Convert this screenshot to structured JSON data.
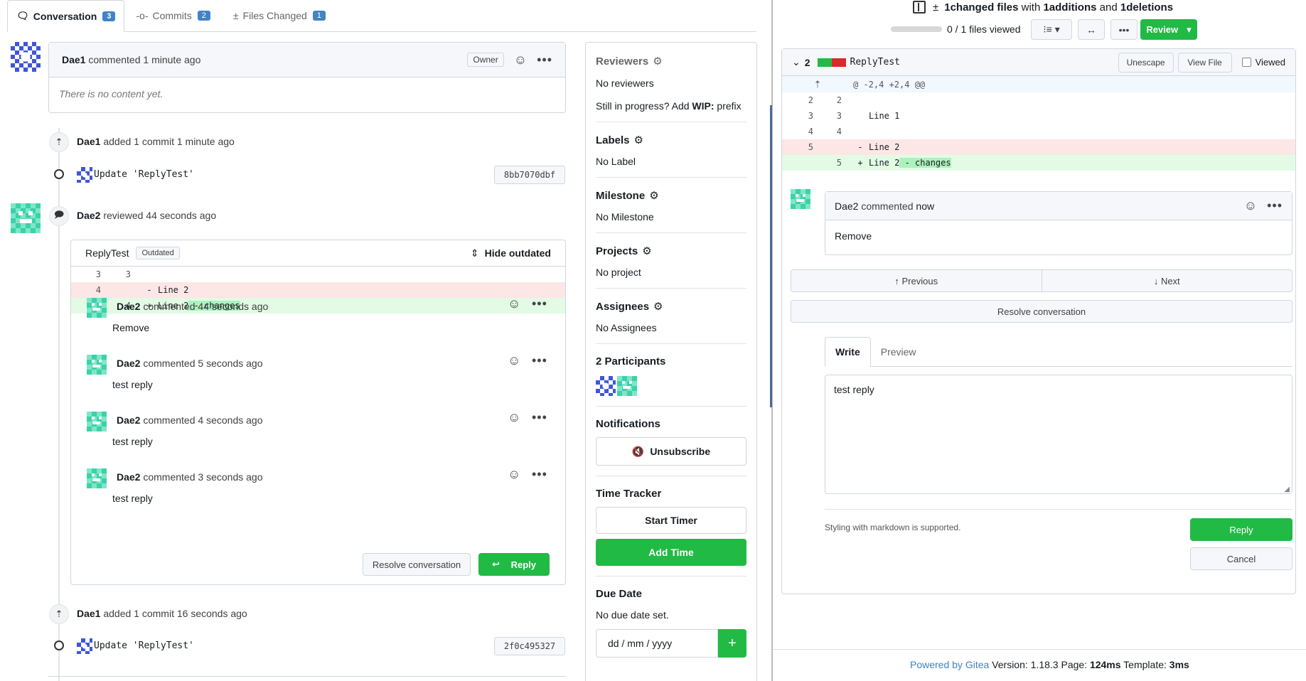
{
  "tabs": [
    {
      "label": "Conversation",
      "count": "3"
    },
    {
      "label": "Commits",
      "count": "2"
    },
    {
      "label": "Files Changed",
      "count": "1"
    }
  ],
  "first_comment": {
    "author": "Dae1",
    "action": "commented",
    "time": "1 minute ago",
    "role": "Owner",
    "body": "There is no content yet."
  },
  "event1": {
    "author": "Dae1",
    "text": "added 1 commit 1 minute ago",
    "commit_msg": "Update 'ReplyTest'",
    "sha": "8bb7070dbf"
  },
  "review": {
    "author": "Dae2",
    "text": "reviewed 44 seconds ago",
    "file": "ReplyTest",
    "outdated": "Outdated",
    "hide_outdated": "Hide outdated",
    "diff": [
      {
        "old": "3",
        "new": "3",
        "sign": "",
        "code": ""
      },
      {
        "old": "4",
        "new": "",
        "sign": "-",
        "code": "Line 2"
      },
      {
        "old": "",
        "new": "4",
        "sign": "+",
        "code": "Line 2",
        "hl": " - changes"
      }
    ],
    "comments": [
      {
        "author": "Dae2",
        "action": "commented",
        "time": "44 seconds ago",
        "body": "Remove"
      },
      {
        "author": "Dae2",
        "action": "commented",
        "time": "5 seconds ago",
        "body": "test reply"
      },
      {
        "author": "Dae2",
        "action": "commented",
        "time": "4 seconds ago",
        "body": "test reply"
      },
      {
        "author": "Dae2",
        "action": "commented",
        "time": "3 seconds ago",
        "body": "test reply"
      }
    ],
    "resolve_label": "Resolve conversation",
    "reply_label": "Reply"
  },
  "event2": {
    "author": "Dae1",
    "text": "added 1 commit 16 seconds ago",
    "commit_msg": "Update 'ReplyTest'",
    "sha": "2f0c495327"
  },
  "sidebar": {
    "reviewers_h": "Reviewers",
    "reviewers_v": "No reviewers",
    "wip_pre": "Still in progress? Add ",
    "wip_b": "WIP:",
    "wip_post": " prefix",
    "labels_h": "Labels",
    "labels_v": "No Label",
    "milestone_h": "Milestone",
    "milestone_v": "No Milestone",
    "projects_h": "Projects",
    "projects_v": "No project",
    "assignees_h": "Assignees",
    "assignees_v": "No Assignees",
    "participants_h": "2 Participants",
    "notifications_h": "Notifications",
    "unsubscribe": "Unsubscribe",
    "time_h": "Time Tracker",
    "start_timer": "Start Timer",
    "add_time": "Add Time",
    "due_h": "Due Date",
    "due_v": "No due date set.",
    "date_placeholder": "dd / mm / yyyy",
    "plus": "+"
  },
  "right": {
    "summary": {
      "count": "1",
      "a": " changed files",
      "with": " with ",
      "adds": "1",
      "a2": " additions",
      "and": " and ",
      "dels": "1",
      "a3": " deletions"
    },
    "progress": "0 / 1 files viewed",
    "review_btn": "Review",
    "file": {
      "count": "2",
      "name": "ReplyTest",
      "unescape": "Unescape",
      "view_file": "View File",
      "viewed": "Viewed"
    },
    "hunk": "@ -2,4 +2,4 @@",
    "diff": [
      {
        "old": "2",
        "new": "2",
        "sign": "",
        "code": ""
      },
      {
        "old": "3",
        "new": "3",
        "sign": "",
        "code": "Line 1"
      },
      {
        "old": "4",
        "new": "4",
        "sign": "",
        "code": ""
      },
      {
        "old": "5",
        "new": "",
        "sign": "-",
        "code": "Line 2"
      },
      {
        "old": "",
        "new": "5",
        "sign": "+",
        "code": "Line 2",
        "hl": " - changes"
      }
    ],
    "comment": {
      "author": "Dae2",
      "action": "commented",
      "time": "now",
      "body": "Remove"
    },
    "previous": "↑ Previous",
    "next": "↓ Next",
    "resolve": "Resolve conversation",
    "write_tab": "Write",
    "preview_tab": "Preview",
    "textarea": "test reply",
    "markdown_note": "Styling with markdown is supported.",
    "reply": "Reply",
    "cancel": "Cancel",
    "footer": {
      "powered": "Powered by Gitea",
      "version": " Version: 1.18.3 Page: ",
      "page_ms": "124ms",
      "tpl": " Template: ",
      "tpl_ms": "3ms"
    }
  },
  "colors": {
    "green": "#21ba45",
    "blue": "#4183c4",
    "del": "#fde6e6",
    "add": "#e3fbe5"
  }
}
